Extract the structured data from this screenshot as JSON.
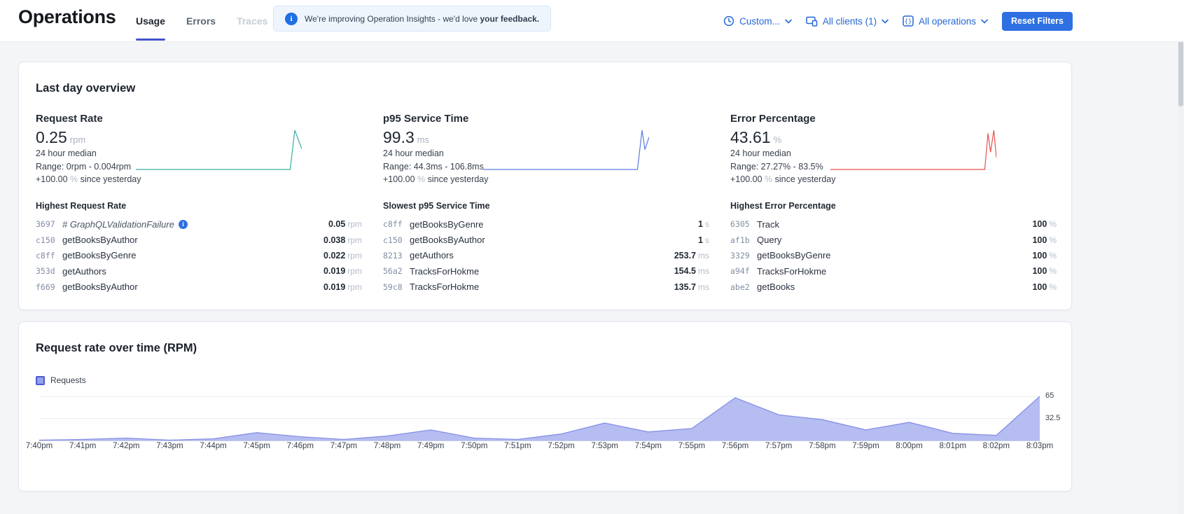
{
  "header": {
    "title": "Operations",
    "tabs": [
      "Usage",
      "Errors",
      "Traces"
    ],
    "banner": {
      "prefix": "We're improving Operation Insights - we'd love ",
      "emphasis": "your feedback."
    },
    "filters": {
      "time_label": "Custom...",
      "clients_label": "All clients (1)",
      "operations_label": "All operations",
      "reset_label": "Reset Filters"
    }
  },
  "overview": {
    "title": "Last day overview",
    "metrics": [
      {
        "name": "Request Rate",
        "value": "0.25",
        "unit": "rpm",
        "median": "24 hour median",
        "range": "Range: 0rpm - 0.004rpm",
        "delta": "+100.00",
        "delta_unit": "%",
        "delta_suffix": "since yesterday"
      },
      {
        "name": "p95 Service Time",
        "value": "99.3",
        "unit": "ms",
        "median": "24 hour median",
        "range": "Range: 44.3ms - 106.8ms",
        "delta": "+100.00",
        "delta_unit": "%",
        "delta_suffix": "since yesterday"
      },
      {
        "name": "Error Percentage",
        "value": "43.61",
        "unit": "%",
        "median": "24 hour median",
        "range": "Range: 27.27% - 83.5%",
        "delta": "+100.00",
        "delta_unit": "%",
        "delta_suffix": "since yesterday"
      }
    ],
    "lists": [
      {
        "title": "Highest Request Rate",
        "rows": [
          {
            "id": "3697",
            "name": "# GraphQLValidationFailure",
            "italic": true,
            "info": true,
            "value": "0.05",
            "unit": "rpm"
          },
          {
            "id": "c150",
            "name": "getBooksByAuthor",
            "value": "0.038",
            "unit": "rpm"
          },
          {
            "id": "c8ff",
            "name": "getBooksByGenre",
            "value": "0.022",
            "unit": "rpm"
          },
          {
            "id": "353d",
            "name": "getAuthors",
            "value": "0.019",
            "unit": "rpm"
          },
          {
            "id": "f669",
            "name": "getBooksByAuthor",
            "value": "0.019",
            "unit": "rpm"
          }
        ]
      },
      {
        "title": "Slowest p95 Service Time",
        "rows": [
          {
            "id": "c8ff",
            "name": "getBooksByGenre",
            "value": "1",
            "unit": "s"
          },
          {
            "id": "c150",
            "name": "getBooksByAuthor",
            "value": "1",
            "unit": "s"
          },
          {
            "id": "8213",
            "name": "getAuthors",
            "value": "253.7",
            "unit": "ms"
          },
          {
            "id": "56a2",
            "name": "TracksForHokme",
            "value": "154.5",
            "unit": "ms"
          },
          {
            "id": "59c8",
            "name": "TracksForHokme",
            "value": "135.7",
            "unit": "ms"
          }
        ]
      },
      {
        "title": "Highest Error Percentage",
        "rows": [
          {
            "id": "6305",
            "name": "Track",
            "value": "100",
            "unit": "%"
          },
          {
            "id": "af1b",
            "name": "Query",
            "value": "100",
            "unit": "%"
          },
          {
            "id": "3329",
            "name": "getBooksByGenre",
            "value": "100",
            "unit": "%"
          },
          {
            "id": "a94f",
            "name": "TracksForHokme",
            "value": "100",
            "unit": "%"
          },
          {
            "id": "abe2",
            "name": "getBooks",
            "value": "100",
            "unit": "%"
          }
        ]
      }
    ]
  },
  "chart_data": [
    {
      "type": "area",
      "title": "Request rate over time (RPM)",
      "legend": [
        "Requests"
      ],
      "legend_position": "top-left",
      "categories": [
        "7:40pm",
        "7:41pm",
        "7:42pm",
        "7:43pm",
        "7:44pm",
        "7:45pm",
        "7:46pm",
        "7:47pm",
        "7:48pm",
        "7:49pm",
        "7:50pm",
        "7:51pm",
        "7:52pm",
        "7:53pm",
        "7:54pm",
        "7:55pm",
        "7:56pm",
        "7:57pm",
        "7:58pm",
        "7:59pm",
        "8:00pm",
        "8:01pm",
        "8:02pm",
        "8:03pm"
      ],
      "values": [
        1,
        2,
        4,
        1,
        3,
        12,
        6,
        2,
        7,
        16,
        4,
        2,
        10,
        26,
        13,
        18,
        63,
        38,
        31,
        16,
        27,
        11,
        8,
        65
      ],
      "xlabel": "",
      "ylabel": "",
      "ylim": [
        0,
        65
      ],
      "yticks": [
        32.5,
        65
      ],
      "grid": true,
      "fill_color": "#b5bdf1",
      "line_color": "#8790e7"
    },
    {
      "type": "line",
      "name": "request-rate-sparkline",
      "color": "#3cafa3",
      "x": [
        0,
        0.93,
        0.958,
        1
      ],
      "y": [
        0.0002,
        0.0002,
        0.004,
        0.0022
      ]
    },
    {
      "type": "line",
      "name": "p95-sparkline",
      "color": "#5b7ce2",
      "x": [
        0,
        0.93,
        0.958,
        0.975,
        1
      ],
      "y": [
        44.5,
        44.5,
        106.8,
        76,
        96
      ]
    },
    {
      "type": "line",
      "name": "error-sparkline",
      "color": "#e4534f",
      "x": [
        0,
        0.93,
        0.95,
        0.965,
        0.985,
        1
      ],
      "y": [
        27.3,
        27.3,
        79,
        52,
        83.5,
        44
      ]
    }
  ],
  "colors": {
    "accent_button": "#2e70e2",
    "link_blue": "#2667d6",
    "tab_underline": "#4353cc",
    "banner_bg": "#eef5fd",
    "request_spark": "#3cafa3",
    "p95_spark": "#5b7ce2",
    "error_spark": "#e4534f",
    "area_fill": "#b5bdf1",
    "area_line": "#8790e7"
  }
}
